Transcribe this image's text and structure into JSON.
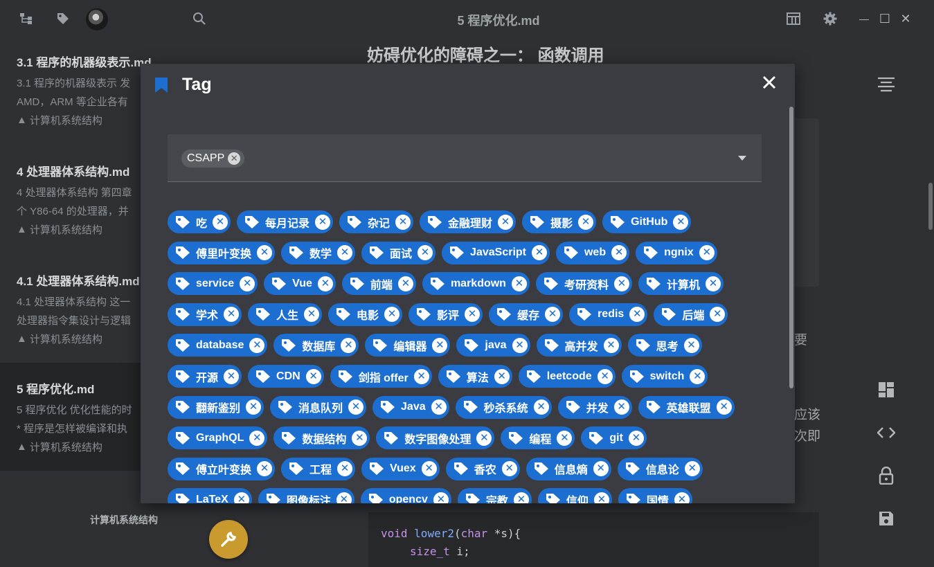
{
  "window": {
    "title": "5 程序优化.md",
    "controls": {
      "minimize": "—",
      "maximize": "☐",
      "close": "✕"
    }
  },
  "toolbar_icons": [
    "tree-icon",
    "tag-icon",
    "avatar",
    "search-icon"
  ],
  "right_toolbar_icons": [
    "layout-icon",
    "gear-icon"
  ],
  "sidebar": {
    "notes": [
      {
        "title": "3.1 程序的机器级表示.md",
        "line1": "3.1 程序的机器级表示 发",
        "line2": "AMD，ARM 等企业各有",
        "tag": "计算机系统结构"
      },
      {
        "title": "4 处理器体系结构.md",
        "line1": "4 处理器体系结构 第四章",
        "line2": "个 Y86-64 的处理器，并",
        "tag": "计算机系统结构"
      },
      {
        "title": "4.1 处理器体系结构.md",
        "line1": "4.1 处理器体系结构 这一",
        "line2": "处理器指令集设计与逻辑",
        "tag": "计算机系统结构"
      },
      {
        "title": "5 程序优化.md",
        "line1": "5 程序优化 优化性能的时",
        "line2": "* 程序是怎样被编译和执",
        "tag": "计算机系统结构"
      }
    ],
    "footer": "计算机系统结构"
  },
  "editor": {
    "heading": "妨碍优化的障碍之一： 函数调用",
    "peek_right": [
      "要",
      "应该",
      "次即"
    ],
    "code": {
      "line1_kw": "void",
      "line1_fn": "lower2",
      "line1_rest_open": "(",
      "line1_type": "char",
      "line1_rest": " *s){",
      "line2_type": "size_t",
      "line2_rest": " i;"
    }
  },
  "dialog": {
    "title": "Tag",
    "selected_chip": "CSAPP",
    "rows": [
      [
        "吃",
        "每月记录",
        "杂记",
        "金融理财",
        "摄影",
        "GitHub"
      ],
      [
        "傅里叶变换",
        "数学",
        "面试",
        "JavaScript",
        "web",
        "ngnix"
      ],
      [
        "service",
        "Vue",
        "前端",
        "markdown",
        "考研资料",
        "计算机"
      ],
      [
        "学术",
        "人生",
        "电影",
        "影评",
        "缓存",
        "redis",
        "后端"
      ],
      [
        "database",
        "数据库",
        "编辑器",
        "java",
        "高并发",
        "思考"
      ],
      [
        "开源",
        "CDN",
        "剑指 offer",
        "算法",
        "leetcode",
        "switch"
      ],
      [
        "翻新鉴别",
        "消息队列",
        "Java",
        "秒杀系统",
        "并发",
        "英雄联盟"
      ],
      [
        "GraphQL",
        "数据结构",
        "数字图像处理",
        "编程",
        "git"
      ],
      [
        "傅立叶变换",
        "工程",
        "Vuex",
        "香农",
        "信息熵",
        "信息论"
      ],
      [
        "LaTeX",
        "图像标注",
        "opencv",
        "宗教",
        "信仰",
        "国情"
      ]
    ]
  },
  "colors": {
    "tag_bg": "#1c6fd1",
    "dialog_bg": "#3a3c41",
    "fab": "#c99a2e"
  }
}
